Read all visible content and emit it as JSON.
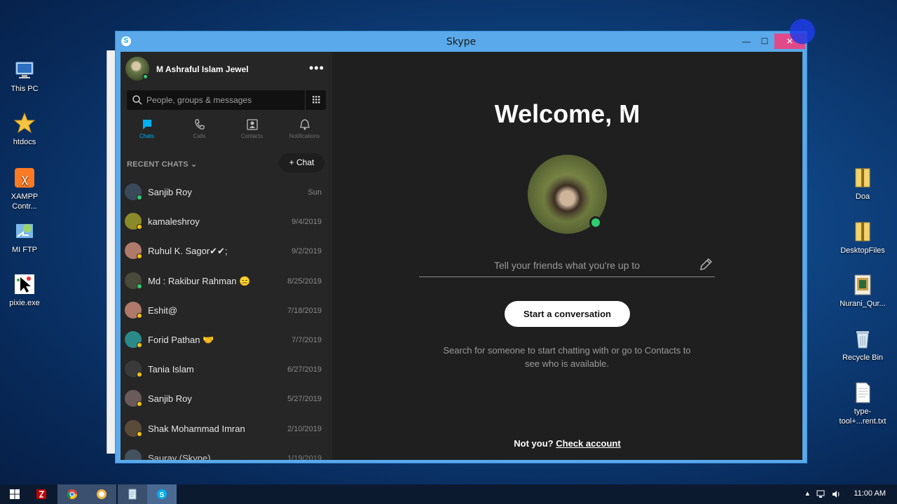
{
  "desktop": {
    "left_icons": [
      {
        "label": "This PC",
        "icon": "computer-icon"
      },
      {
        "label": "htdocs",
        "icon": "star-folder-icon"
      },
      {
        "label": "XAMPP Contr...",
        "icon": "xampp-icon"
      },
      {
        "label": "MI FTP",
        "icon": "ftp-icon"
      },
      {
        "label": "pixie.exe",
        "icon": "pixie-icon"
      }
    ],
    "right_icons": [
      {
        "label": "Doa",
        "icon": "folder-zip-icon"
      },
      {
        "label": "DesktopFiles",
        "icon": "folder-zip-icon"
      },
      {
        "label": "Nurani_Qur...",
        "icon": "book-icon"
      },
      {
        "label": "Recycle Bin",
        "icon": "recycle-bin-icon"
      },
      {
        "label": "type-tool+...rent.txt",
        "icon": "text-file-icon"
      }
    ]
  },
  "window": {
    "title": "Skype",
    "minimize": "—",
    "maximize": "☐",
    "close": "✕"
  },
  "sidebar": {
    "profile_name": "M Ashraful Islam Jewel",
    "more": "•••",
    "search_placeholder": "People, groups & messages",
    "nav": [
      {
        "label": "Chats",
        "icon": "chat-icon",
        "active": true
      },
      {
        "label": "Calls",
        "icon": "phone-icon",
        "active": false
      },
      {
        "label": "Contacts",
        "icon": "contacts-icon",
        "active": false
      },
      {
        "label": "Notifications",
        "icon": "bell-icon",
        "active": false
      }
    ],
    "recent_label": "RECENT CHATS",
    "new_chat_label": "+ Chat",
    "chats": [
      {
        "name": "Sanjib Roy",
        "date": "Sun",
        "avatar_color": "#3a4a5a",
        "status_color": "#2ecc71"
      },
      {
        "name": "kamaleshroy",
        "date": "9/4/2019",
        "avatar_color": "#8a8a2a",
        "status_color": "#f1c40f"
      },
      {
        "name": "Ruhul K. Sagor✔✔;",
        "date": "9/2/2019",
        "avatar_color": "#b07a6a",
        "status_color": "#f1c40f"
      },
      {
        "name": "Md : Rakibur Rahman 😑",
        "date": "8/25/2019",
        "avatar_color": "#4a4a3a",
        "status_color": "#2ecc71"
      },
      {
        "name": "Eshit@",
        "date": "7/18/2019",
        "avatar_color": "#b07a6a",
        "status_color": "#f1c40f"
      },
      {
        "name": "Forid Pathan 🤝",
        "date": "7/7/2019",
        "avatar_color": "#2a8a8a",
        "status_color": "#f1c40f"
      },
      {
        "name": "Tania Islam",
        "date": "6/27/2019",
        "avatar_color": "#3a3a3a",
        "status_color": "#f1c40f"
      },
      {
        "name": "Sanjib Roy",
        "date": "5/27/2019",
        "avatar_color": "#6a5a5a",
        "status_color": "#f1c40f"
      },
      {
        "name": "Shak  Mohammad Imran",
        "date": "2/10/2019",
        "avatar_color": "#5a4a3a",
        "status_color": "#f1c40f"
      },
      {
        "name": "Saurav (Skype)",
        "date": "1/19/2019",
        "avatar_color": "#4a5a6a",
        "status_color": "#f1c40f"
      }
    ]
  },
  "main": {
    "welcome": "Welcome, M",
    "status_placeholder": "Tell your friends what you're up to",
    "start_button": "Start a conversation",
    "hint": "Search for someone to start chatting with or go to Contacts to see who is available.",
    "not_you": "Not you?",
    "check_account": "Check account"
  },
  "taskbar": {
    "items": [
      {
        "name": "start-button",
        "icon": "windows-icon"
      },
      {
        "name": "filezilla",
        "icon": "filezilla-icon"
      },
      {
        "name": "chrome",
        "icon": "chrome-icon"
      },
      {
        "name": "pixie",
        "icon": "app-icon"
      },
      {
        "name": "notepad",
        "icon": "notepad-icon"
      },
      {
        "name": "skype",
        "icon": "skype-icon"
      }
    ],
    "time": "11:00 AM"
  }
}
